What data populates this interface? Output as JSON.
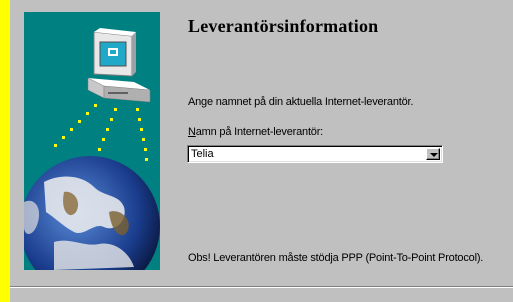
{
  "wizard": {
    "title": "Leverantörsinformation",
    "prompt": "Ange namnet på din aktuella Internet-leverantör.",
    "field_label_mnemonic": "N",
    "field_label_rest": "amn på Internet-leverantör:",
    "provider_value": "Telia",
    "note": "Obs! Leverantören måste stödja PPP (Point-To-Point Protocol)."
  },
  "colors": {
    "background": "#ffff00",
    "dialog": "#c0c0c0",
    "art_background": "#008080",
    "signal_dots": "#ffff00"
  },
  "icons": {
    "art": "computer-globe-illustration",
    "dropdown": "chevron-down-icon"
  }
}
